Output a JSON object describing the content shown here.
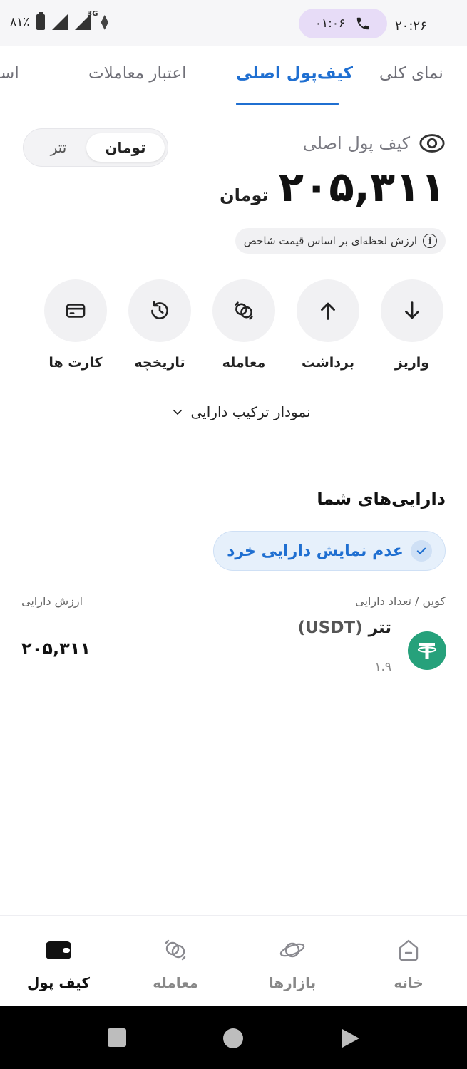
{
  "status_bar": {
    "battery": "۸۱٪",
    "network": "3G",
    "call_duration": "۰۱:۰۶",
    "time": "۲۰:۲۶"
  },
  "tabs": [
    {
      "label": "نمای کلی",
      "active": false
    },
    {
      "label": "کیف‌پول اصلی",
      "active": true
    },
    {
      "label": "اعتبار معاملات",
      "active": false
    },
    {
      "label": "استیکینگ",
      "active": false
    }
  ],
  "wallet": {
    "title": "کیف پول اصلی",
    "balance": "۲۰۵,۳۱۱",
    "balance_unit": "تومان",
    "price_note": "ارزش لحظه‌ای بر اساس قیمت شاخص",
    "currency_toggle": {
      "selected": "تومان",
      "other": "تتر"
    }
  },
  "actions": [
    {
      "label": "واریز",
      "icon": "arrow-down-icon"
    },
    {
      "label": "برداشت",
      "icon": "arrow-up-icon"
    },
    {
      "label": "معامله",
      "icon": "exchange-icon"
    },
    {
      "label": "تاریخچه",
      "icon": "history-icon"
    },
    {
      "label": "کارت ها",
      "icon": "card-icon"
    }
  ],
  "composition_label": "نمودار ترکیب دارایی",
  "assets": {
    "title": "دارایی‌های شما",
    "hide_small_label": "عدم نمایش دارایی خرد",
    "col_coin": "کوین / تعداد دارایی",
    "col_value": "ارزش دارایی",
    "items": [
      {
        "name": "تتر",
        "symbol": "(USDT)",
        "quantity": "۱.۹",
        "value": "۲۰۵,۳۱۱"
      }
    ]
  },
  "bottom_nav": [
    {
      "label": "خانه",
      "icon": "home-icon",
      "active": false
    },
    {
      "label": "بازارها",
      "icon": "planet-icon",
      "active": false
    },
    {
      "label": "معامله",
      "icon": "exchange-icon",
      "active": false
    },
    {
      "label": "کیف پول",
      "icon": "wallet-icon",
      "active": true
    }
  ],
  "colors": {
    "accent": "#1f6fd1",
    "tether_green": "#26a17b",
    "call_pill": "#e7dcf7"
  }
}
